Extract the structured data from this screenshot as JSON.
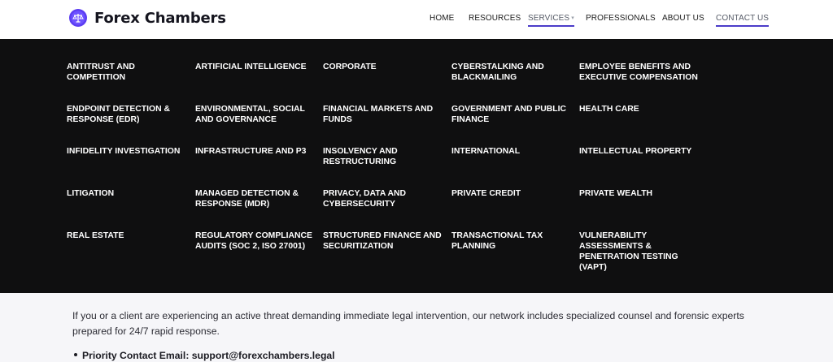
{
  "brand": {
    "name": "Forex Chambers",
    "icon": "scales-of-justice-icon",
    "icon_color": "#5b3df2"
  },
  "nav": {
    "items": [
      {
        "label": "HOME",
        "active": false
      },
      {
        "label": "RESOURCES",
        "active": false
      },
      {
        "label": "SERVICES",
        "active": true,
        "has_dropdown": true
      },
      {
        "label": "PROFESSIONALS",
        "active": false
      },
      {
        "label": "ABOUT US",
        "active": false
      },
      {
        "label": "CONTACT US",
        "active": true
      }
    ],
    "underline_color": "#4b3cc9"
  },
  "services": [
    "ANTITRUST AND COMPETITION",
    "ARTIFICIAL INTELLIGENCE",
    "CORPORATE",
    "CYBERSTALKING AND BLACKMAILING",
    "EMPLOYEE BENEFITS AND EXECUTIVE COMPENSATION",
    "ENDPOINT DETECTION & RESPONSE (EDR)",
    "ENVIRONMENTAL, SOCIAL AND GOVERNANCE",
    "FINANCIAL MARKETS AND FUNDS",
    "GOVERNMENT AND PUBLIC FINANCE",
    "HEALTH CARE",
    "INFIDELITY INVESTIGATION",
    "INFRASTRUCTURE AND P3",
    "INSOLVENCY AND RESTRUCTURING",
    "INTERNATIONAL",
    "INTELLECTUAL PROPERTY",
    "LITIGATION",
    "MANAGED DETECTION & RESPONSE (MDR)",
    "PRIVACY, DATA AND CYBERSECURITY",
    "PRIVATE CREDIT",
    "PRIVATE WEALTH",
    "REAL ESTATE",
    "REGULATORY COMPLIANCE AUDITS (SOC 2, ISO 27001)",
    "STRUCTURED FINANCE AND SECURITIZATION",
    "TRANSACTIONAL TAX PLANNING",
    "VULNERABILITY ASSESSMENTS & PENETRATION TESTING (VAPT)"
  ],
  "content": {
    "paragraph": "If you or a client are experiencing an active threat demanding immediate legal intervention, our network includes specialized counsel and forensic experts prepared for 24/7 rapid response.",
    "priority_contact": "Priority Contact Email: support@forexchambers.legal"
  }
}
